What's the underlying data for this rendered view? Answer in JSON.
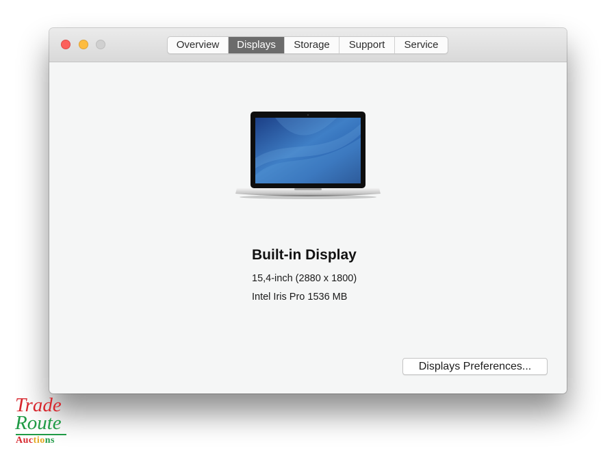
{
  "window": {
    "traffic_lights": [
      "close",
      "minimize",
      "zoom"
    ],
    "tabs": [
      {
        "label": "Overview",
        "active": false
      },
      {
        "label": "Displays",
        "active": true
      },
      {
        "label": "Storage",
        "active": false
      },
      {
        "label": "Support",
        "active": false
      },
      {
        "label": "Service",
        "active": false
      }
    ]
  },
  "display": {
    "icon": "macbook-pro-laptop-icon",
    "title": "Built-in Display",
    "size_resolution": "15,4-inch (2880 x 1800)",
    "graphics": "Intel Iris Pro 1536 MB"
  },
  "buttons": {
    "preferences_label": "Displays Preferences..."
  },
  "watermark": {
    "line1": "Trade",
    "line2": "Route",
    "line3": "Auctions"
  },
  "colors": {
    "close": "#fc605c",
    "minimize": "#fdbc40",
    "zoom_inactive": "#d0d0d0",
    "active_tab": "#6b6b6b",
    "logo_red": "#d7262d",
    "logo_green": "#1f9a45",
    "logo_gold": "#e1a51c"
  }
}
